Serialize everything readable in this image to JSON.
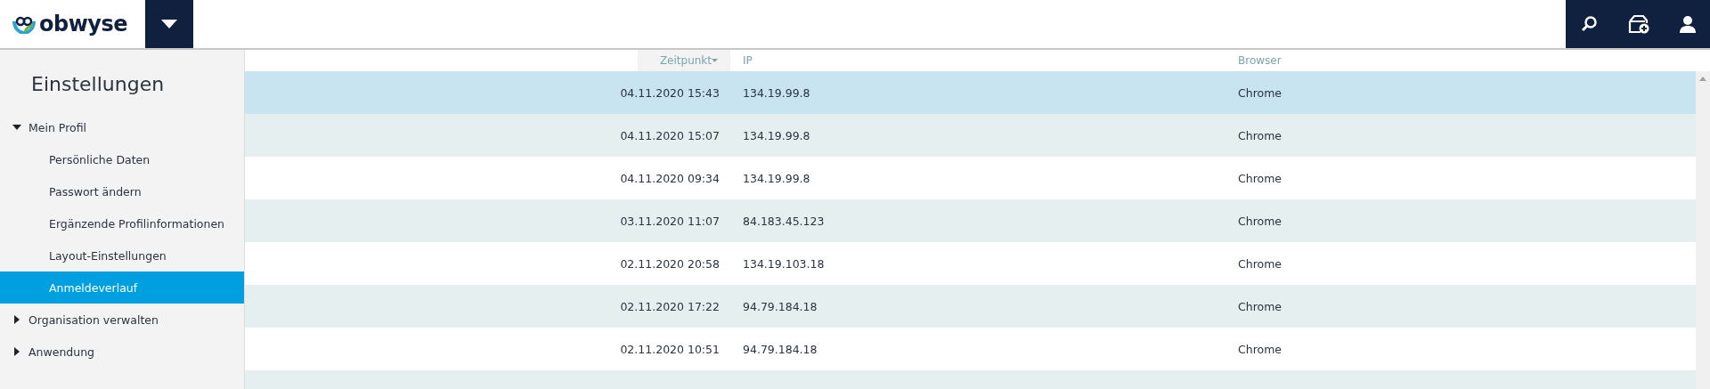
{
  "logo": {
    "text": "obwyse"
  },
  "sidebar": {
    "title": "Einstellungen",
    "items": [
      {
        "label": "Mein Profil",
        "expanded": true,
        "children": [
          {
            "label": "Persönliche Daten",
            "selected": false
          },
          {
            "label": "Passwort ändern",
            "selected": false
          },
          {
            "label": "Ergänzende Profilinformationen",
            "selected": false
          },
          {
            "label": "Layout-Einstellungen",
            "selected": false
          },
          {
            "label": "Anmeldeverlauf",
            "selected": true
          }
        ]
      },
      {
        "label": "Organisation verwalten",
        "expanded": false
      },
      {
        "label": "Anwendung",
        "expanded": false
      }
    ]
  },
  "table": {
    "columns": [
      {
        "label": "Zeitpunkt",
        "sorted": true
      },
      {
        "label": "IP",
        "sorted": false
      },
      {
        "label": "Browser",
        "sorted": false
      }
    ],
    "rows": [
      {
        "time": "04.11.2020 15:43",
        "ip": "134.19.99.8",
        "browser": "Chrome",
        "selected": true
      },
      {
        "time": "04.11.2020 15:07",
        "ip": "134.19.99.8",
        "browser": "Chrome",
        "selected": false
      },
      {
        "time": "04.11.2020 09:34",
        "ip": "134.19.99.8",
        "browser": "Chrome",
        "selected": false
      },
      {
        "time": "03.11.2020 11:07",
        "ip": "84.183.45.123",
        "browser": "Chrome",
        "selected": false
      },
      {
        "time": "02.11.2020 20:58",
        "ip": "134.19.103.18",
        "browser": "Chrome",
        "selected": false
      },
      {
        "time": "02.11.2020 17:22",
        "ip": "94.79.184.18",
        "browser": "Chrome",
        "selected": false
      },
      {
        "time": "02.11.2020 10:51",
        "ip": "94.79.184.18",
        "browser": "Chrome",
        "selected": false
      }
    ]
  }
}
